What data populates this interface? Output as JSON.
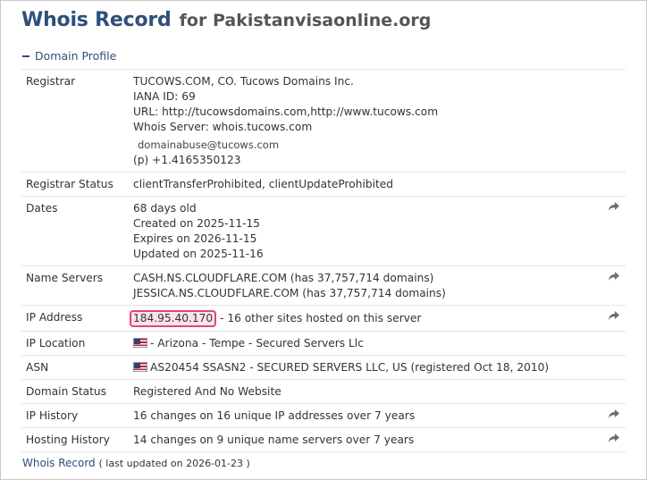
{
  "header": {
    "title": "Whois Record",
    "for_text": "for Pakistanvisaonline.org"
  },
  "section": {
    "label": "Domain Profile"
  },
  "rows": {
    "registrar": {
      "label": "Registrar",
      "lines": [
        "TUCOWS.COM, CO. Tucows Domains Inc.",
        "IANA ID: 69",
        "URL: http://tucowsdomains.com,http://www.tucows.com",
        "Whois Server: whois.tucows.com"
      ],
      "email": "domainabuse@tucows.com",
      "phone_prefix": "(p)",
      "phone": "+1.4165350123"
    },
    "registrar_status": {
      "label": "Registrar Status",
      "value": "clientTransferProhibited, clientUpdateProhibited"
    },
    "dates": {
      "label": "Dates",
      "lines": [
        "68 days old",
        "Created on 2025-11-15",
        "Expires on 2026-11-15",
        "Updated on 2025-11-16"
      ]
    },
    "name_servers": {
      "label": "Name Servers",
      "lines": [
        "CASH.NS.CLOUDFLARE.COM (has 37,757,714 domains)",
        "JESSICA.NS.CLOUDFLARE.COM (has 37,757,714 domains)"
      ]
    },
    "ip_address": {
      "label": "IP Address",
      "ip": "184.95.40.170",
      "suffix": "- 16 other sites hosted on this server"
    },
    "ip_location": {
      "label": "IP Location",
      "value": "- Arizona - Tempe - Secured Servers Llc"
    },
    "asn": {
      "label": "ASN",
      "value": "AS20454 SSASN2 - SECURED SERVERS LLC, US (registered Oct 18, 2010)"
    },
    "domain_status": {
      "label": "Domain Status",
      "value": "Registered And No Website"
    },
    "ip_history": {
      "label": "IP History",
      "value": "16 changes on 16 unique IP addresses over 7 years"
    },
    "hosting_history": {
      "label": "Hosting History",
      "value": "14 changes on 9 unique name servers over 7 years"
    }
  },
  "footer": {
    "link": "Whois Record",
    "note": "( last updated on 2026-01-23 )"
  },
  "colors": {
    "accent": "#2e4f7a",
    "highlight_border": "#e0457b",
    "highlight_fill": "#fbe3ec"
  }
}
